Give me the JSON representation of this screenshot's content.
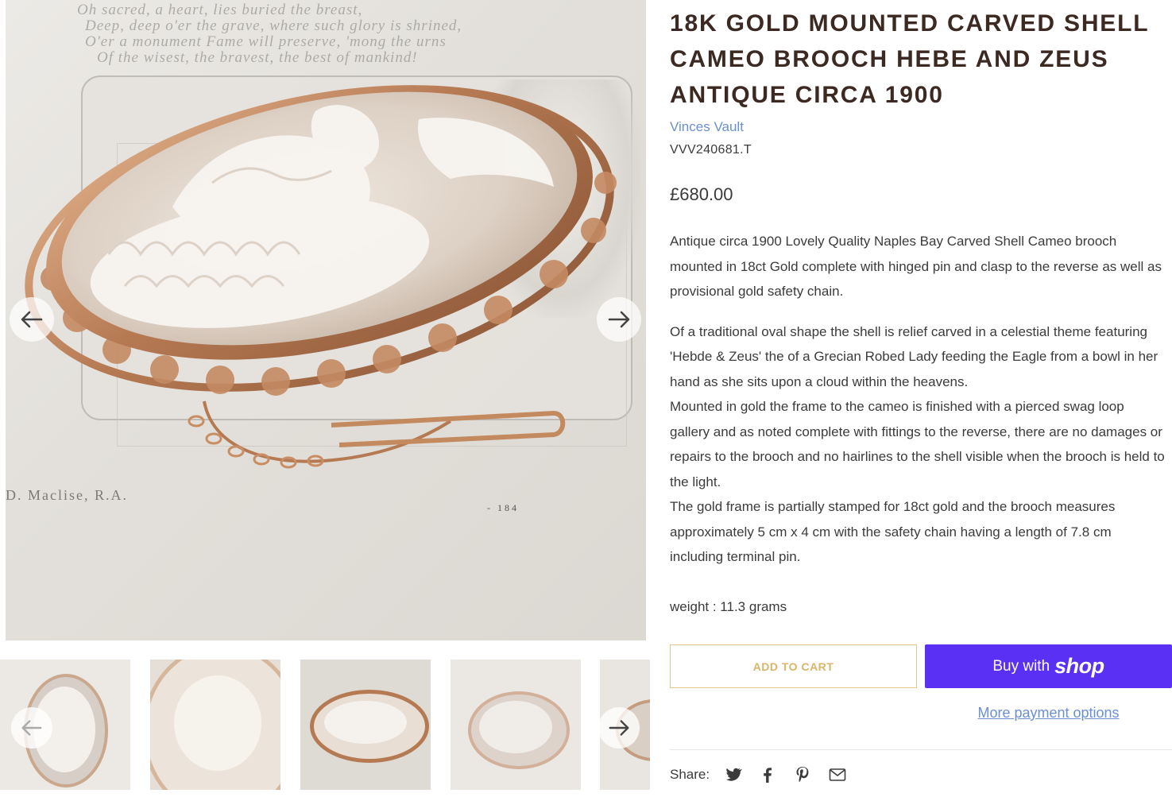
{
  "product": {
    "title": "18K GOLD MOUNTED CARVED SHELL CAMEO BROOCH HEBE AND ZEUS ANTIQUE CIRCA 1900",
    "vendor": "Vinces Vault",
    "sku": "VVV240681.T",
    "price": "£680.00",
    "description": [
      "Antique circa 1900 Lovely Quality Naples Bay Carved Shell Cameo brooch mounted in 18ct Gold complete with hinged pin and clasp to the reverse as well as provisional gold safety chain.",
      "Of a traditional oval shape the shell is relief carved in a celestial theme featuring 'Hebde & Zeus' the of a Grecian Robed Lady feeding the Eagle from a bowl in her hand as she sits upon a cloud within the heavens.",
      "Mounted in gold the frame to the cameo is finished with a pierced swag loop gallery and as noted complete with fittings to the reverse, there are no damages or repairs to the brooch and no hairlines to the shell visible when the brooch is held to the light.",
      "The gold frame is partially stamped for 18ct gold and the brooch measures approximately 5 cm x 4 cm with the safety chain having a length of 7.8 cm including terminal pin.",
      "weight : 11.3 grams"
    ]
  },
  "gallery": {
    "main_image_alt": "Carved shell cameo brooch in gold frame on engraved paper",
    "paper_lines": [
      "Oh sacred, a heart, lies buried the breast,",
      "Deep, deep o'er the grave, where such glory is shrined,",
      "O'er a monument Fame will preserve, 'mong the urns",
      "Of the wisest, the bravest, the best of mankind!"
    ],
    "caption_left": "D. Maclise, R.A.",
    "caption_right": "- 184",
    "prev_icon": "arrow-left-icon",
    "next_icon": "arrow-right-icon"
  },
  "actions": {
    "add_to_cart": "ADD TO CART",
    "buy_with": "Buy with",
    "shop_brand": "shop",
    "more_payment": "More payment options"
  },
  "share": {
    "label": "Share:",
    "icons": [
      "twitter-icon",
      "facebook-icon",
      "pinterest-icon",
      "email-icon"
    ]
  },
  "colors": {
    "title": "#3c2a22",
    "link": "#6b8fd3",
    "cart_border": "#e4c88a",
    "cart_text": "#d9b46a",
    "shop_pay": "#5a31f4"
  }
}
